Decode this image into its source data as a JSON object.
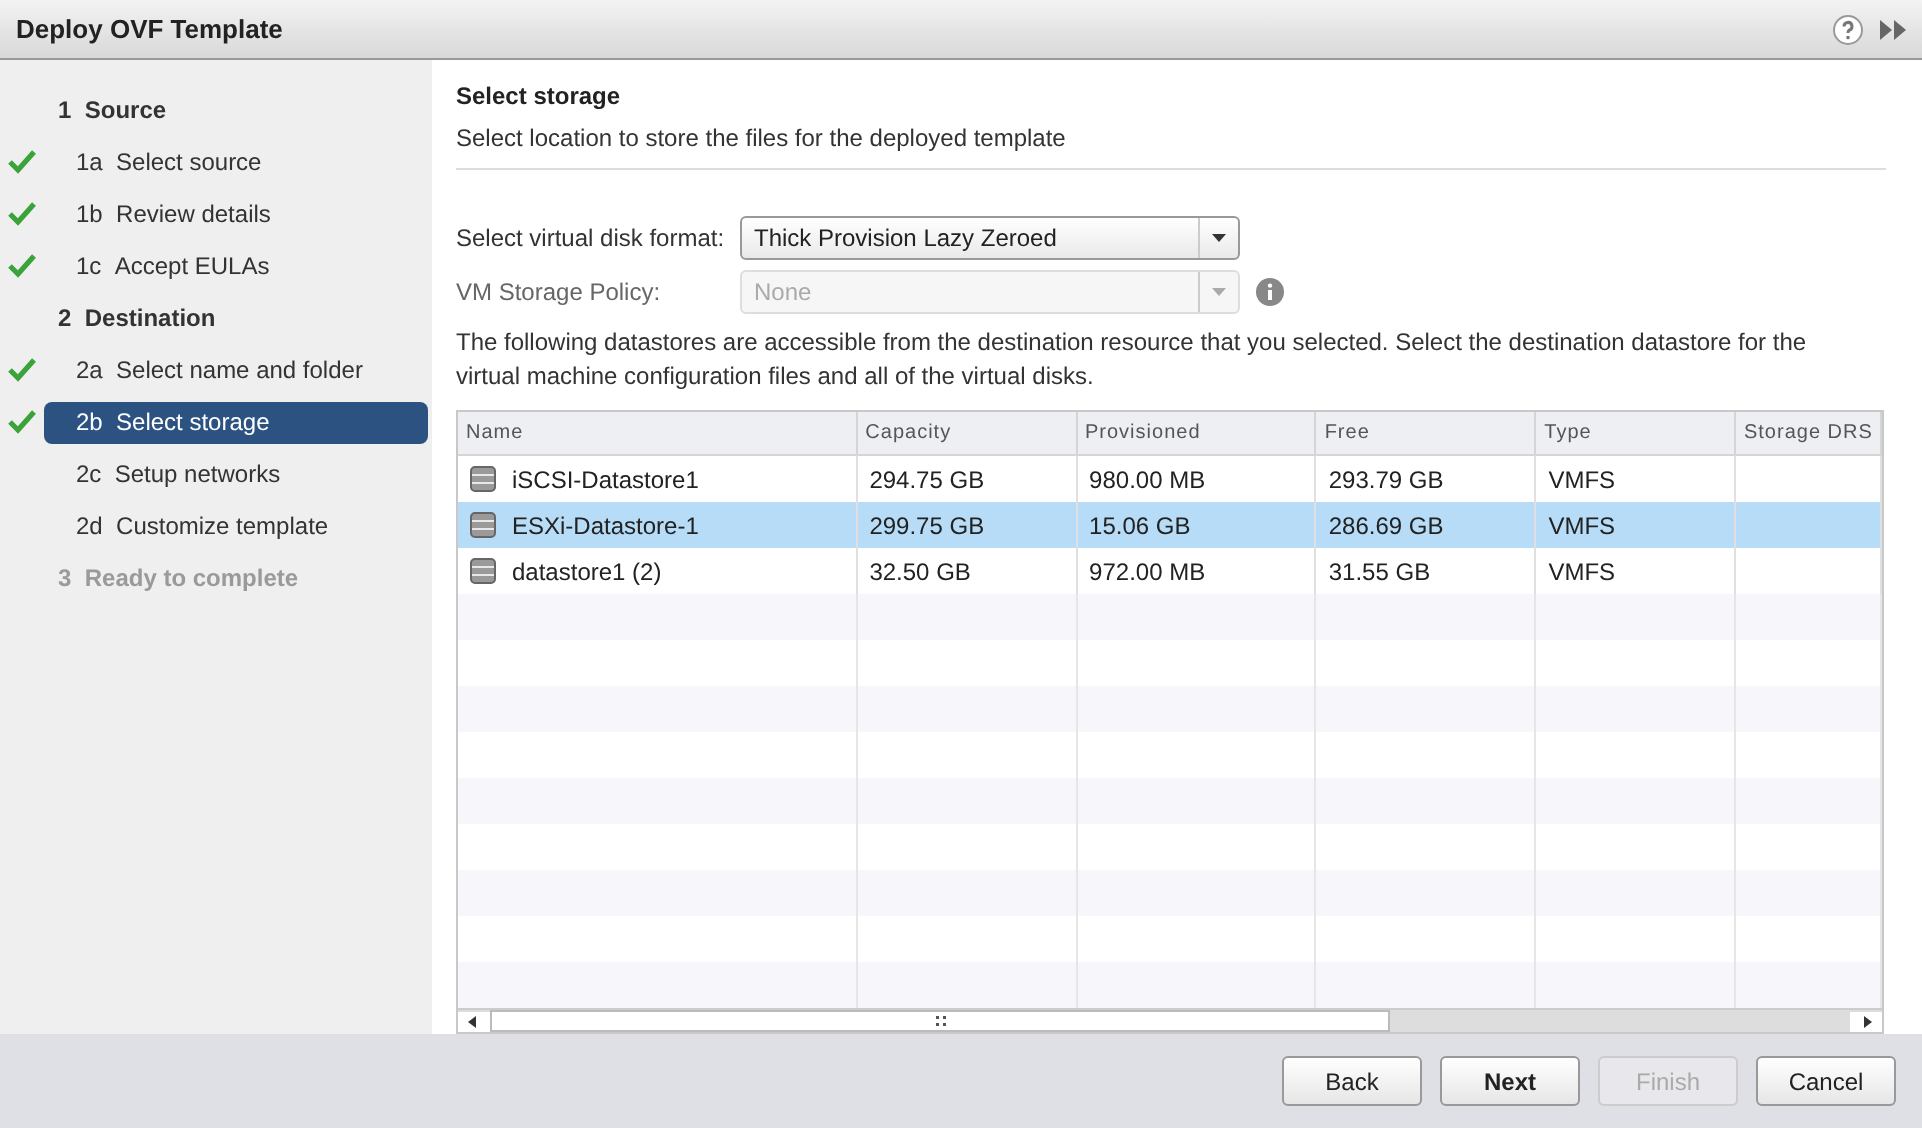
{
  "window": {
    "title": "Deploy OVF Template"
  },
  "steps": [
    {
      "kind": "section",
      "number": "1",
      "label": "Source",
      "checked": false,
      "selected": false,
      "disabled": false
    },
    {
      "kind": "step",
      "number": "1a",
      "label": "Select source",
      "checked": true,
      "selected": false,
      "disabled": false
    },
    {
      "kind": "step",
      "number": "1b",
      "label": "Review details",
      "checked": true,
      "selected": false,
      "disabled": false
    },
    {
      "kind": "step",
      "number": "1c",
      "label": "Accept EULAs",
      "checked": true,
      "selected": false,
      "disabled": false
    },
    {
      "kind": "section",
      "number": "2",
      "label": "Destination",
      "checked": false,
      "selected": false,
      "disabled": false
    },
    {
      "kind": "step",
      "number": "2a",
      "label": "Select name and folder",
      "checked": true,
      "selected": false,
      "disabled": false
    },
    {
      "kind": "step",
      "number": "2b",
      "label": "Select storage",
      "checked": true,
      "selected": true,
      "disabled": false
    },
    {
      "kind": "step",
      "number": "2c",
      "label": "Setup networks",
      "checked": false,
      "selected": false,
      "disabled": false
    },
    {
      "kind": "step",
      "number": "2d",
      "label": "Customize template",
      "checked": false,
      "selected": false,
      "disabled": false
    },
    {
      "kind": "section",
      "number": "3",
      "label": "Ready to complete",
      "checked": false,
      "selected": false,
      "disabled": true
    }
  ],
  "page": {
    "title": "Select storage",
    "subtitle": "Select location to store the files for the deployed template"
  },
  "fields": [
    {
      "label": "Select virtual disk format:",
      "value": "Thick Provision Lazy Zeroed",
      "disabled": false,
      "info": false
    },
    {
      "label": "VM Storage Policy:",
      "value": "None",
      "disabled": true,
      "info": true
    }
  ],
  "description": "The following datastores are accessible from the destination resource that you selected. Select the destination datastore for the virtual machine configuration files and all of the virtual disks.",
  "table": {
    "columns": [
      "Name",
      "Capacity",
      "Provisioned",
      "Free",
      "Type",
      "Storage DRS"
    ],
    "rows": [
      {
        "selected": false,
        "cells": [
          "iSCSI-Datastore1",
          "294.75 GB",
          "980.00 MB",
          "293.79 GB",
          "VMFS",
          ""
        ]
      },
      {
        "selected": true,
        "cells": [
          "ESXi-Datastore-1",
          "299.75 GB",
          "15.06 GB",
          "286.69 GB",
          "VMFS",
          ""
        ]
      },
      {
        "selected": false,
        "cells": [
          "datastore1 (2)",
          "32.50 GB",
          "972.00 MB",
          "31.55 GB",
          "VMFS",
          ""
        ]
      }
    ]
  },
  "buttons": [
    {
      "label": "Back",
      "primary": false,
      "disabled": false
    },
    {
      "label": "Next",
      "primary": true,
      "disabled": false
    },
    {
      "label": "Finish",
      "primary": false,
      "disabled": true
    },
    {
      "label": "Cancel",
      "primary": false,
      "disabled": false
    }
  ]
}
